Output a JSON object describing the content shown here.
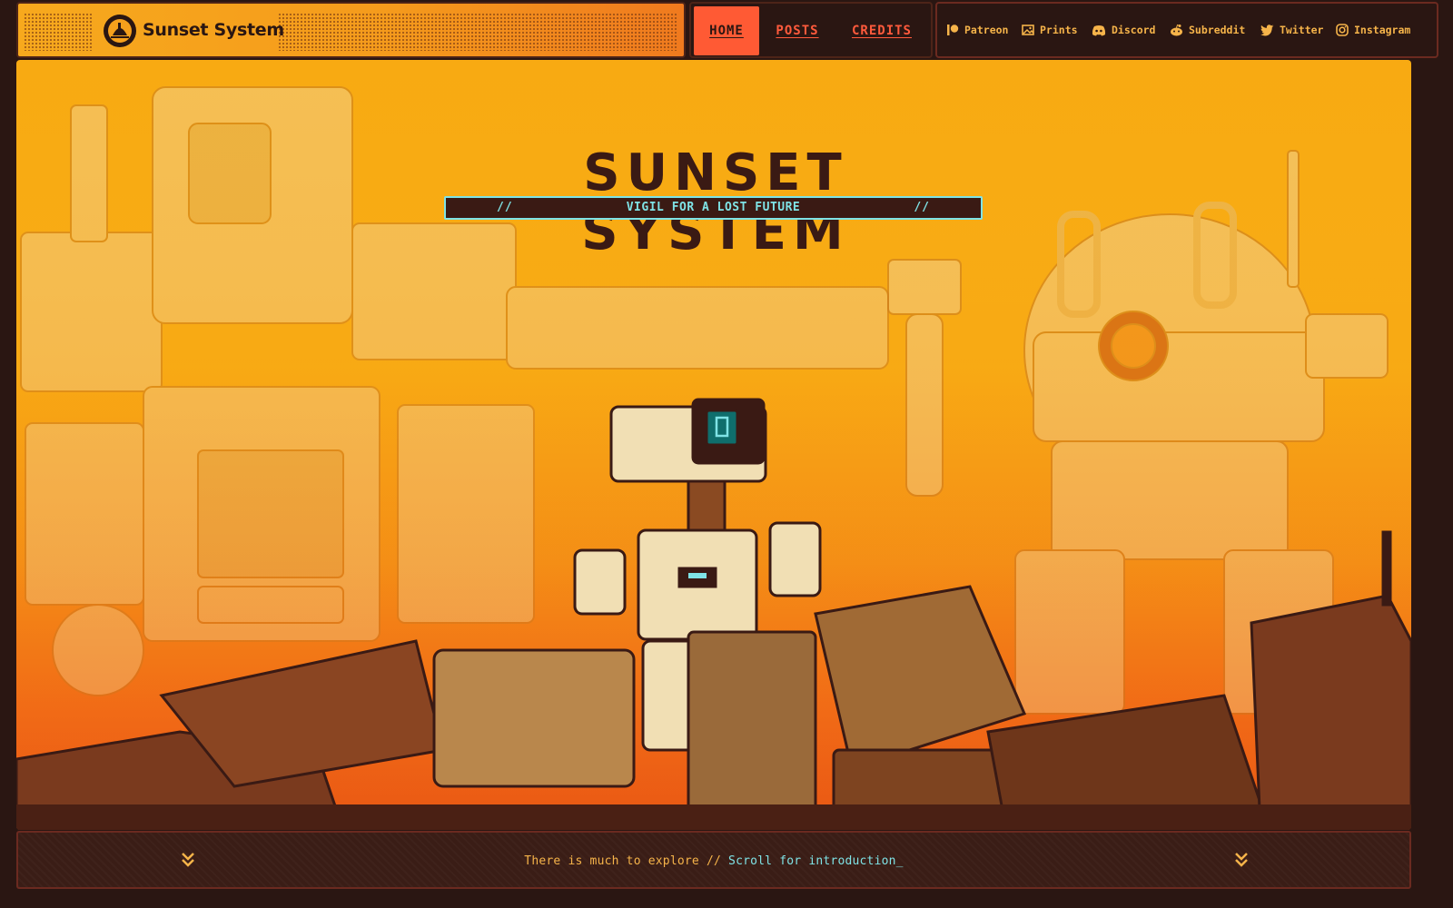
{
  "brand": {
    "name": "Sunset System",
    "logo_icon": "sunset-logo-icon"
  },
  "nav": [
    {
      "label": "HOME",
      "active": true
    },
    {
      "label": "POSTS",
      "active": false
    },
    {
      "label": "CREDITS",
      "active": false
    }
  ],
  "social": [
    {
      "label": "Patreon",
      "icon": "patreon-icon"
    },
    {
      "label": "Prints",
      "icon": "image-icon"
    },
    {
      "label": "Discord",
      "icon": "discord-icon"
    },
    {
      "label": "Subreddit",
      "icon": "reddit-icon"
    },
    {
      "label": "Twitter",
      "icon": "twitter-icon"
    },
    {
      "label": "Instagram",
      "icon": "instagram-icon"
    }
  ],
  "hero": {
    "title": "SUNSET SYSTEM",
    "tagline": "VIGIL FOR A LOST FUTURE",
    "tagline_left": "//",
    "tagline_right": "//"
  },
  "footer": {
    "prompt": "There is much to explore // ",
    "action": "Scroll for introduction_"
  },
  "colors": {
    "accent": "#ff5a34",
    "cyan": "#7fe3e6",
    "dark": "#2a1612",
    "amber": "#f6b44a"
  }
}
